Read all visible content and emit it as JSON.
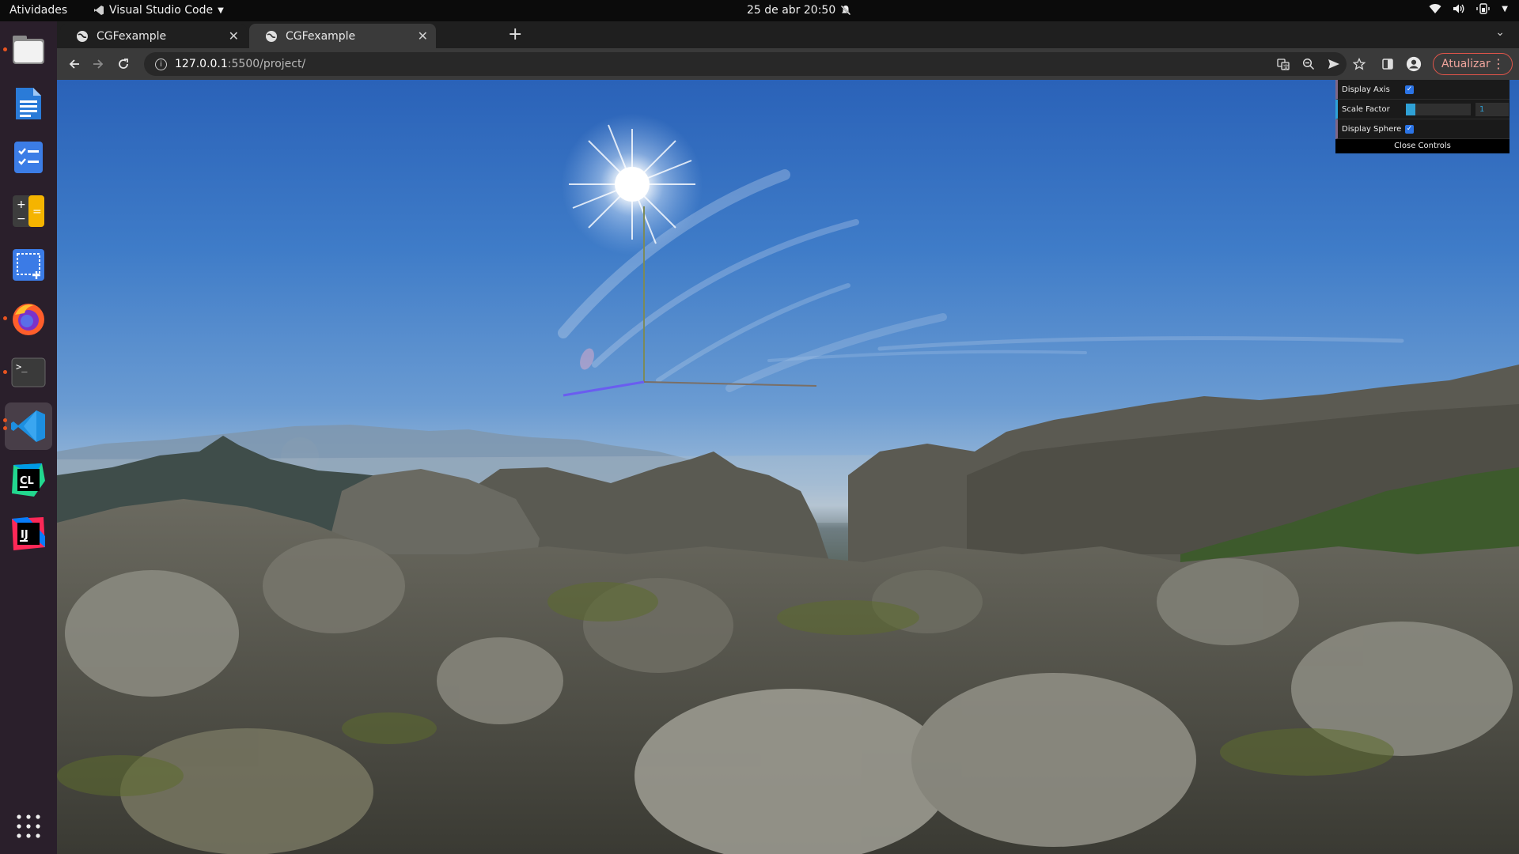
{
  "topbar": {
    "activities": "Atividades",
    "app_name": "Visual Studio Code",
    "clock": "25 de abr  20:50",
    "icons": [
      "notifications-off-icon",
      "wifi-icon",
      "volume-icon",
      "battery-icon",
      "system-menu-chevron-icon"
    ]
  },
  "dock": {
    "items": [
      {
        "name": "files",
        "icon": "folder-icon",
        "running": true
      },
      {
        "name": "writer",
        "icon": "document-icon",
        "running": false
      },
      {
        "name": "tasks",
        "icon": "checklist-icon",
        "running": false
      },
      {
        "name": "calculator",
        "icon": "calculator-icon",
        "running": false
      },
      {
        "name": "screenshot",
        "icon": "screenshot-icon",
        "running": false
      },
      {
        "name": "firefox",
        "icon": "firefox-icon",
        "running": true
      },
      {
        "name": "terminal",
        "icon": "terminal-icon",
        "running": true
      },
      {
        "name": "vscode",
        "icon": "vscode-icon",
        "running": true,
        "active": true
      },
      {
        "name": "clion",
        "icon": "clion-icon",
        "running": false,
        "label": "CL"
      },
      {
        "name": "intellij",
        "icon": "intellij-icon",
        "running": false,
        "label": "IJ"
      }
    ],
    "apps_grid_icon": "show-apps-icon"
  },
  "browser": {
    "tabs": [
      {
        "title": "CGFexample",
        "active": false
      },
      {
        "title": "CGFexample",
        "active": true
      }
    ],
    "new_tab": "+",
    "address": {
      "host": "127.0.0.1",
      "rest": ":5500/project/"
    },
    "update_label": "Atualizar"
  },
  "gui": {
    "display_axis": {
      "label": "Display Axis",
      "checked": true
    },
    "scale_factor": {
      "label": "Scale Factor",
      "value": "1",
      "fraction": 0.0
    },
    "display_sphere": {
      "label": "Display Sphere",
      "checked": true
    },
    "close_label": "Close Controls"
  },
  "colors": {
    "accent_orange": "#e95420",
    "gui_number": "#2fa1d6",
    "gui_bool": "#806787",
    "checkbox": "#2b74e6",
    "update_border": "#e2554a"
  }
}
